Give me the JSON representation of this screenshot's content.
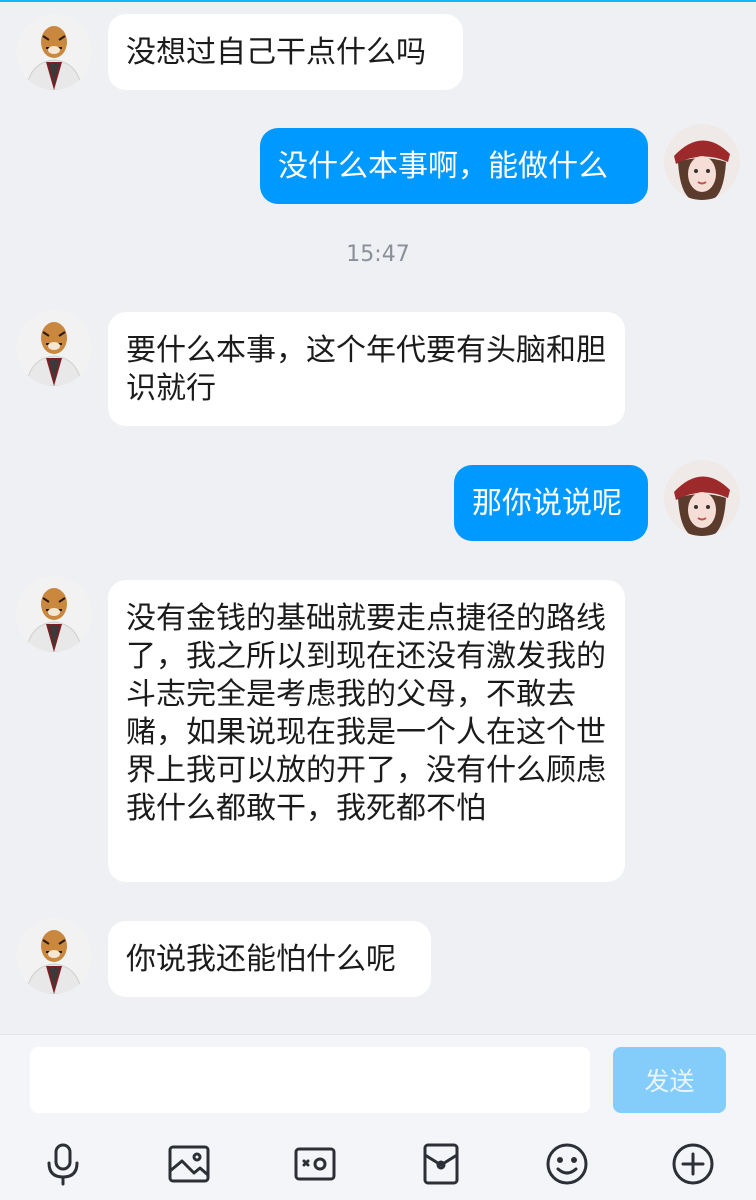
{
  "chat": {
    "messages": [
      {
        "side": "in",
        "text": "没想过自己干点什么吗"
      },
      {
        "side": "out",
        "text": "没什么本事啊，能做什么"
      },
      {
        "side": "in",
        "text": "要什么本事，这个年代要有头脑和胆识就行"
      },
      {
        "side": "out",
        "text": "那你说说呢"
      },
      {
        "side": "in",
        "text": "没有金钱的基础就要走点捷径的路线了，我之所以到现在还没有激发我的斗志完全是考虑我的父母，不敢去赌，如果说现在我是一个人在这个世界上我可以放的开了，没有什么顾虑我什么都敢干，我死都不怕"
      },
      {
        "side": "in",
        "text": "你说我还能怕什么呢"
      }
    ],
    "timestamp": "15:47"
  },
  "input": {
    "placeholder": "",
    "value": "",
    "send_label": "发送"
  },
  "toolbar": {
    "icons": [
      "microphone-icon",
      "image-icon",
      "camera-icon",
      "red-packet-icon",
      "emoji-icon",
      "plus-icon"
    ]
  },
  "colors": {
    "accent": "#0099ff",
    "send_disabled": "#84ccf9",
    "background": "#eff0f3"
  }
}
